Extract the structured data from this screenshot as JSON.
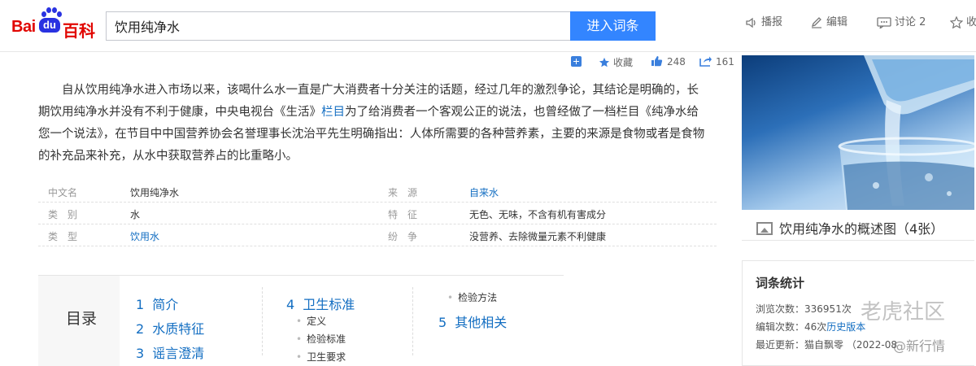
{
  "header": {
    "logo_bai": "Bai",
    "logo_du": "du",
    "logo_baike": "百科",
    "search_value": "饮用纯净水",
    "enter_button": "进入词条",
    "actions": [
      {
        "label": "播报",
        "icon": "speaker-icon"
      },
      {
        "label": "编辑",
        "icon": "pencil-icon"
      },
      {
        "label": "讨论 2",
        "icon": "chat-icon"
      },
      {
        "label": "收",
        "icon": "star-icon"
      }
    ]
  },
  "action_bar": {
    "collect_label": "收藏",
    "like_count": "248",
    "share_count": "161"
  },
  "intro": {
    "text_before": "自从饮用纯净水进入市场以来，该喝什么水一直是广大消费者十分关注的话题，经过几年的激烈争论，其结论是明确的，长期饮用纯净水并没有不利于健康，中央电视台《生活》",
    "link": "栏目",
    "text_after": "为了给消费者一个客观公正的说法，也曾经做了一档栏目《纯净水给您一个说法》，在节目中中国营养协会名誉理事长沈治平先生明确指出：人体所需要的各种营养素，主要的来源是食物或者是食物的补充品来补充，从水中获取营养占的比重略小。"
  },
  "basic_info": {
    "rows": [
      {
        "k1": "中文名",
        "v1": "饮用纯净水",
        "k2": "来　源",
        "v2": "自来水"
      },
      {
        "k1": "类　别",
        "v1": "水",
        "k2": "特　征",
        "v2": "无色、无味，不含有机有害成分"
      },
      {
        "k1": "类　型",
        "v1": "饮用水",
        "k2": "纷　争",
        "v2": "没营养、去除微量元素不利健康"
      }
    ]
  },
  "catalog": {
    "title": "目录",
    "col1": [
      {
        "num": "1",
        "label": "简介"
      },
      {
        "num": "2",
        "label": "水质特征"
      },
      {
        "num": "3",
        "label": "谣言澄清"
      }
    ],
    "col2_item": {
      "num": "4",
      "label": "卫生标准"
    },
    "col2_subs": [
      "定义",
      "检验标准",
      "卫生要求"
    ],
    "col3_sub": "检验方法",
    "col3_item": {
      "num": "5",
      "label": "其他相关"
    }
  },
  "summary_pic": {
    "caption": "饮用纯净水的概述图（4张）"
  },
  "stats": {
    "title": "词条统计",
    "views_label": "浏览次数：",
    "views_value": "336951次",
    "edits_label": "编辑次数：",
    "edits_value": "46次",
    "history_link": "历史版本",
    "updated_label": "最近更新：",
    "updated_user": "猫自飘零",
    "updated_date": "（2022-08"
  },
  "watermark": {
    "main": "老虎社区",
    "sub": "@新行情"
  },
  "colors": {
    "brand_red": "#e10601",
    "brand_blue": "#2932e1",
    "button_blue": "#3385ff",
    "link_blue": "#136ec2"
  }
}
